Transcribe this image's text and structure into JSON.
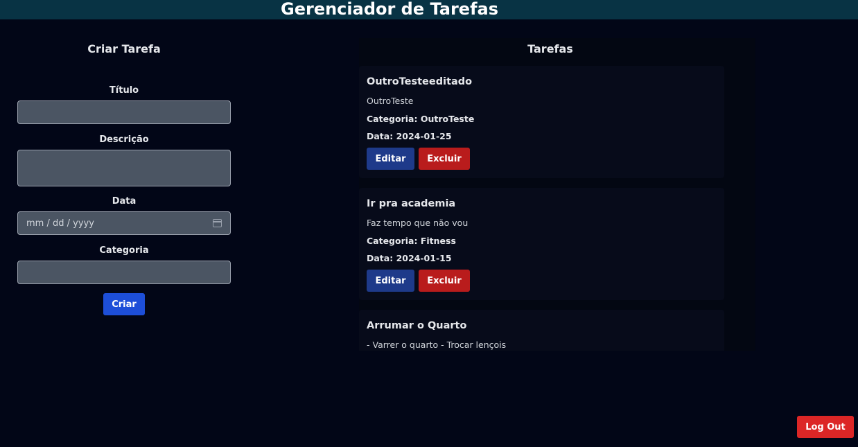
{
  "app": {
    "title": "Gerenciador de Tarefas"
  },
  "form": {
    "title": "Criar Tarefa",
    "fields": {
      "title_label": "Título",
      "title_value": "",
      "description_label": "Descrição",
      "description_value": "",
      "date_label": "Data",
      "date_placeholder": "mm / dd / yyyy",
      "category_label": "Categoria",
      "category_value": ""
    },
    "submit_label": "Criar"
  },
  "tasks": {
    "title": "Tarefas",
    "items": [
      {
        "title": "OutroTesteeditado",
        "description": "OutroTeste",
        "category": "Categoria: OutroTeste",
        "date": "Data: 2024-01-25",
        "edit_label": "Editar",
        "delete_label": "Excluir"
      },
      {
        "title": "Ir pra academia",
        "description": "Faz tempo que não vou",
        "category": "Categoria: Fitness",
        "date": "Data: 2024-01-15",
        "edit_label": "Editar",
        "delete_label": "Excluir"
      },
      {
        "title": "Arrumar o Quarto",
        "description": "- Varrer o quarto - Trocar lençois"
      }
    ]
  },
  "logout_label": "Log Out",
  "colors": {
    "background": "#020617",
    "header": "#083344",
    "create_button": "#1d4ed8",
    "edit_button": "#1e3a8a",
    "delete_button": "#b91c1c",
    "logout_button": "#dc2626"
  },
  "icons": {
    "date_picker": "calendar-icon"
  }
}
